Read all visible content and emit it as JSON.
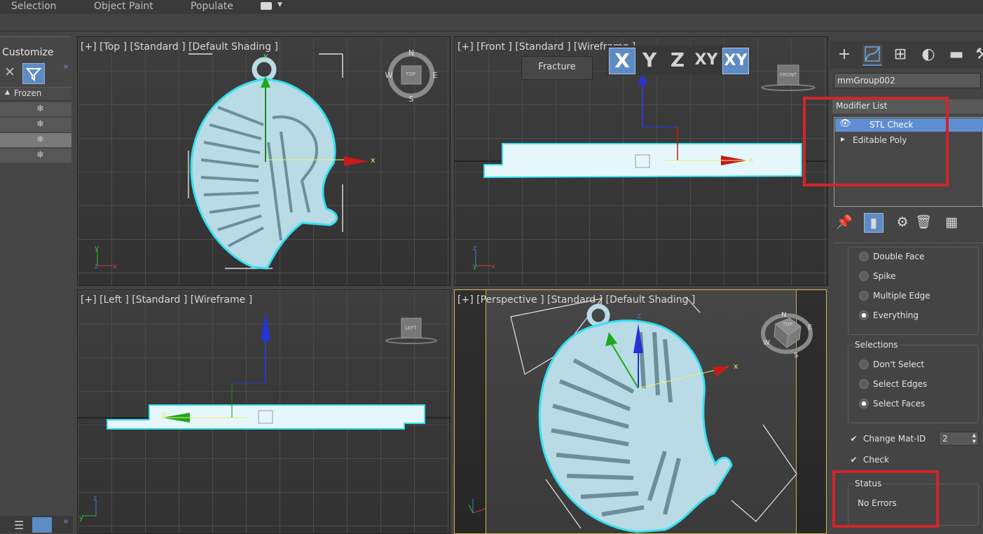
{
  "ribbon": {
    "tabs": [
      "Selection",
      "Object Paint",
      "Populate"
    ]
  },
  "scene_explorer": {
    "title": "Customize",
    "frozen_header": "Frozen"
  },
  "viewports": {
    "top": "[+] [Top ] [Standard ] [Default Shading ]",
    "front": "[+] [Front ] [Standard ] [Wireframe ]",
    "left": "[+] [Left ] [Standard ] [Wireframe ]",
    "perspective": "[+] [Perspective ] [Standard ] [Default Shading ]",
    "cube_top": "TOP",
    "cube_front": "FRONT",
    "cube_left": "LEFT"
  },
  "axis_toolbar": {
    "fracture": "Fracture",
    "x": "X",
    "y": "Y",
    "z": "Z",
    "xy": "XY",
    "xy2": "XY"
  },
  "command_panel": {
    "object_name": "mmGroup002",
    "modifier_list": "Modifier List",
    "stack": [
      "STL Check",
      "Editable Poly"
    ],
    "check_options": [
      "Double Face",
      "Spike",
      "Multiple Edge",
      "Everything"
    ],
    "selections_title": "Selections",
    "selections": [
      "Don't Select",
      "Select Edges",
      "Select Faces"
    ],
    "change_mat_id": "Change Mat-ID",
    "mat_id_value": "2",
    "check_label": "Check",
    "status_title": "Status",
    "status_value": "No Errors"
  },
  "colors": {
    "accent": "#5d8bc4",
    "highlight_box": "#d1252b",
    "object": "#b9dbe6"
  }
}
